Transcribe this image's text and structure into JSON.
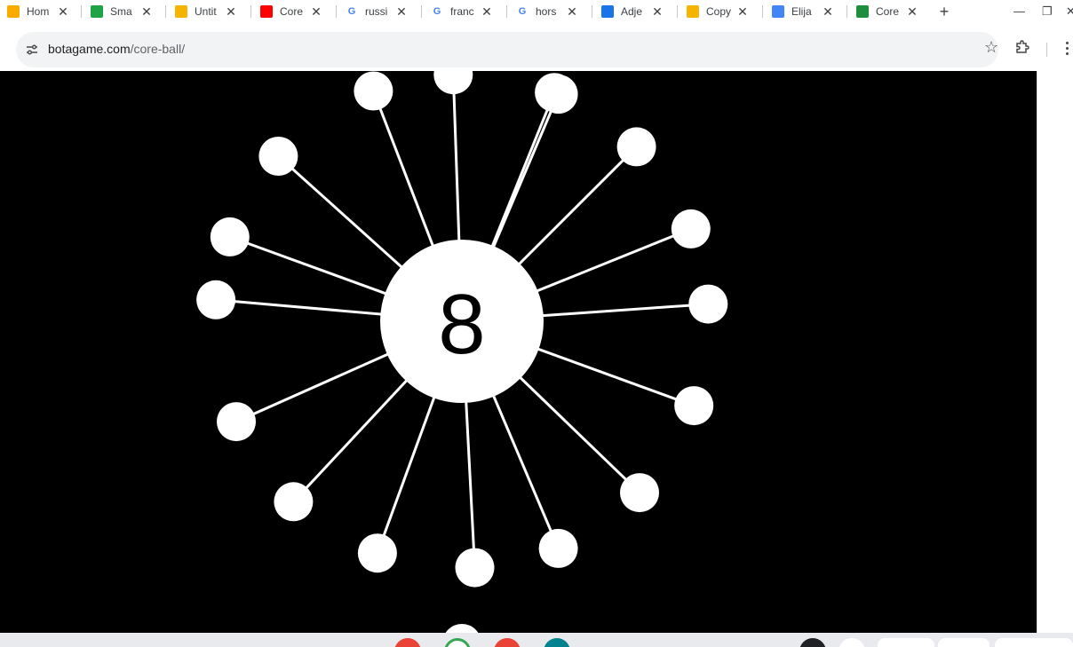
{
  "browser": {
    "tabs": [
      {
        "label": "Hom",
        "icon": "classroom-icon",
        "color": "#f9ab00"
      },
      {
        "label": "Sma",
        "icon": "smart-icon",
        "color": "#1ea446"
      },
      {
        "label": "Untit",
        "icon": "slides-icon",
        "color": "#f4b400"
      },
      {
        "label": "Core",
        "icon": "youtube-icon",
        "color": "#ff0000"
      },
      {
        "label": "russi",
        "icon": "google-icon",
        "color": "#4285f4"
      },
      {
        "label": "franc",
        "icon": "google-icon",
        "color": "#4285f4"
      },
      {
        "label": "hors",
        "icon": "google-icon",
        "color": "#4285f4"
      },
      {
        "label": "Adje",
        "icon": "contacts-icon",
        "color": "#1a73e8"
      },
      {
        "label": "Copy",
        "icon": "slides-icon",
        "color": "#f4b400"
      },
      {
        "label": "Elija",
        "icon": "docs-icon",
        "color": "#4285f4"
      },
      {
        "label": "Core",
        "icon": "core-ball-icon",
        "color": "#1e8e3e"
      }
    ],
    "new_tab_symbol": "+",
    "url_host": "botagame.com",
    "url_path": "/core-ball/"
  },
  "game": {
    "title": "Core Ball",
    "balls_remaining": "8",
    "background": "#000000",
    "pin_color": "#ffffff",
    "stuck_pin_angles_deg": [
      -92,
      -68,
      -111,
      -138,
      -160,
      -175,
      156,
      133,
      110,
      87,
      67,
      44,
      20,
      -4,
      -22,
      -45,
      -67
    ]
  }
}
